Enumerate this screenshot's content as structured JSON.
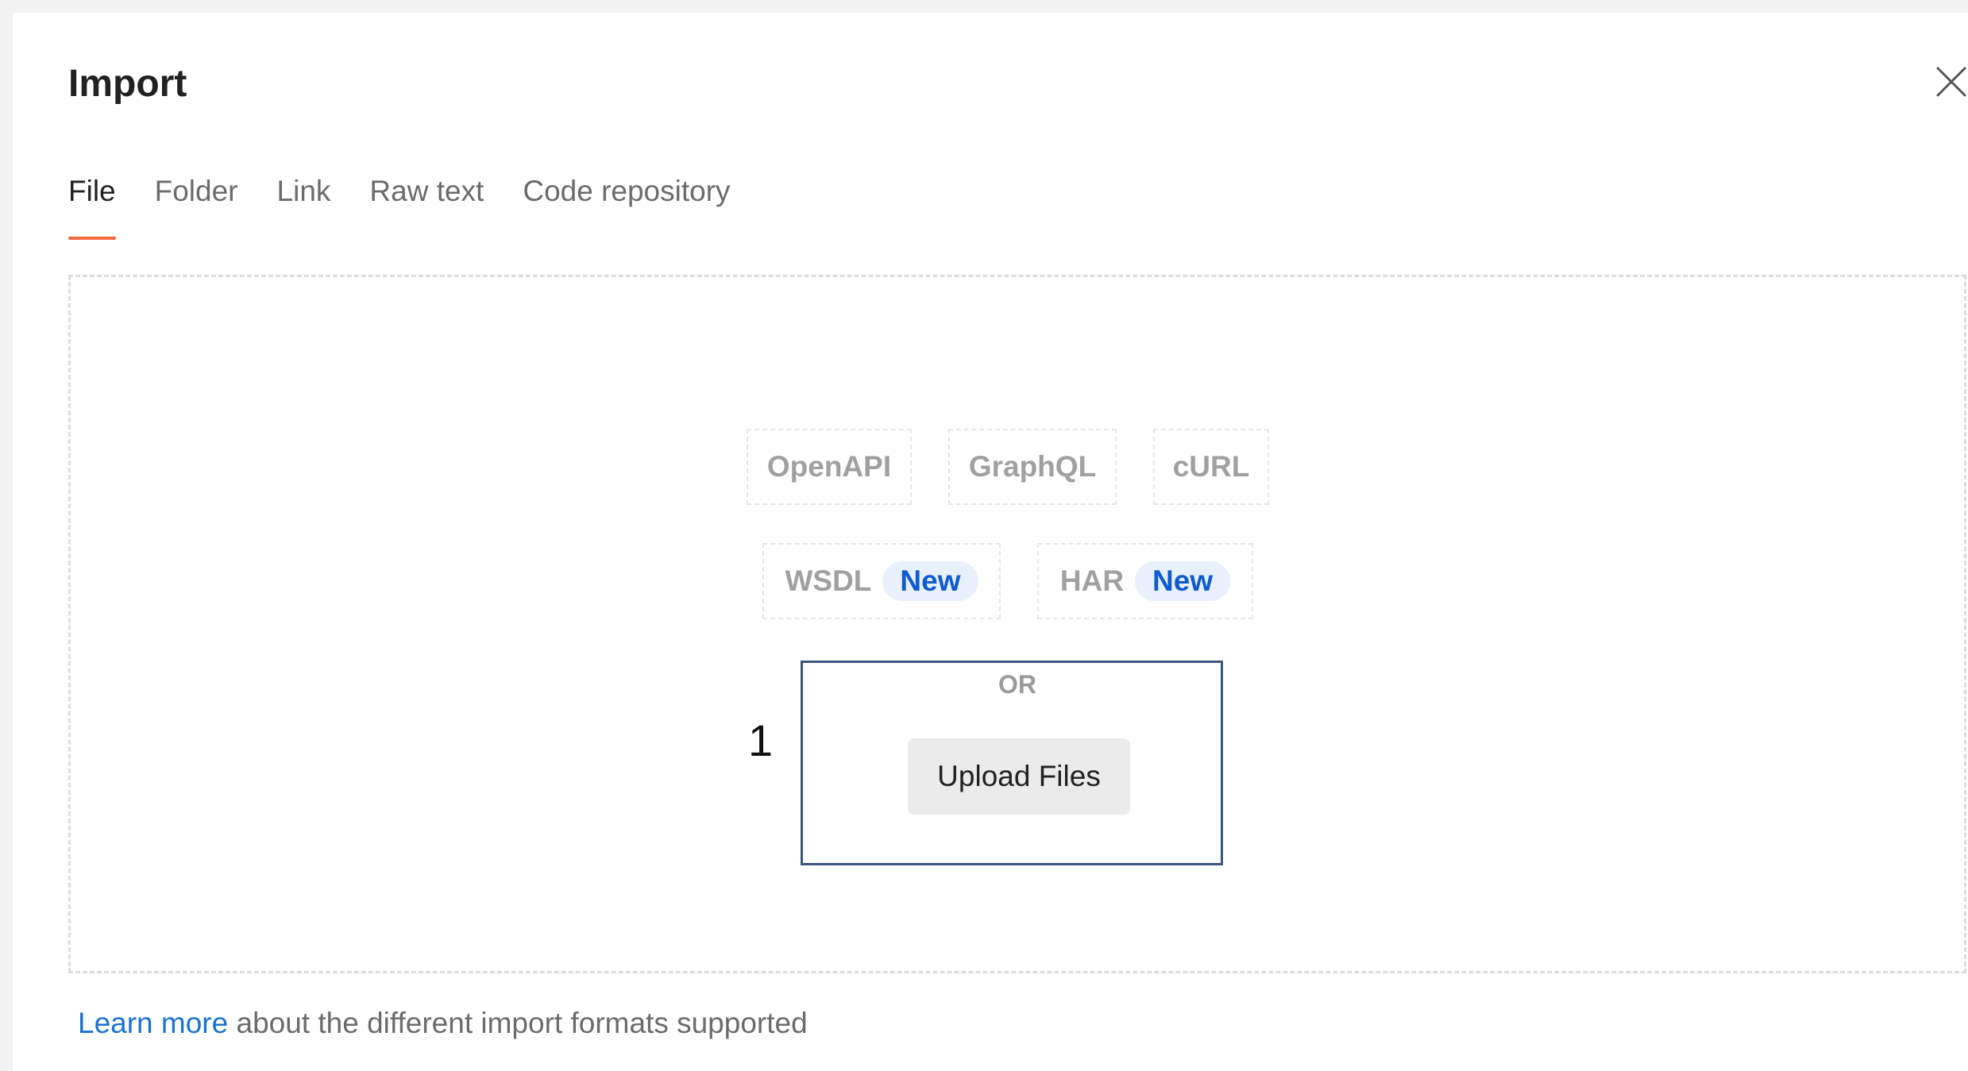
{
  "dialog": {
    "title": "Import",
    "close_icon": "close-icon"
  },
  "tabs": [
    {
      "label": "File",
      "active": true
    },
    {
      "label": "Folder",
      "active": false
    },
    {
      "label": "Link",
      "active": false
    },
    {
      "label": "Raw text",
      "active": false
    },
    {
      "label": "Code repository",
      "active": false
    }
  ],
  "formats": {
    "openapi": "OpenAPI",
    "graphql": "GraphQL",
    "curl": "cURL",
    "wsdl": "WSDL",
    "wsdl_badge": "New",
    "har": "HAR",
    "har_badge": "New"
  },
  "upload": {
    "or_label": "OR",
    "button_label": "Upload Files"
  },
  "annotation": {
    "number": "1"
  },
  "footer": {
    "link_text": "Learn more",
    "rest_text": " about the different import formats supported"
  },
  "colors": {
    "accent": "#f26b3a",
    "badge_text": "#0e5bd0",
    "badge_bg": "#e8f0fb",
    "link": "#1a73d1",
    "annotation_border": "#3a5680"
  }
}
